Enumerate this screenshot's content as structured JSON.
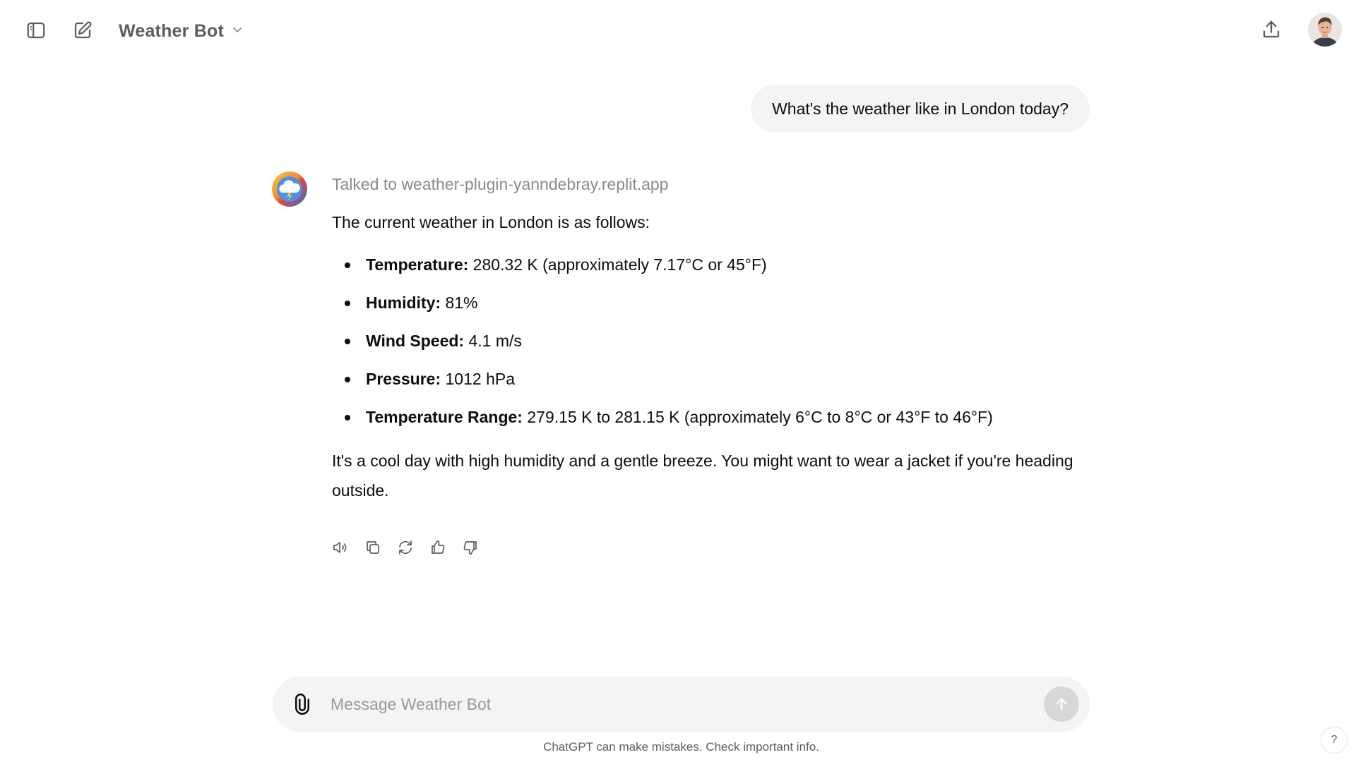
{
  "header": {
    "model_name": "Weather Bot"
  },
  "conversation": {
    "user_message": "What's the weather like in London today?",
    "assistant": {
      "plugin_note": "Talked to weather-plugin-yanndebray.replit.app",
      "intro": "The current weather in London is as follows:",
      "facts": [
        {
          "label": "Temperature:",
          "value": " 280.32 K (approximately 7.17°C or 45°F)"
        },
        {
          "label": "Humidity:",
          "value": " 81%"
        },
        {
          "label": "Wind Speed:",
          "value": " 4.1 m/s"
        },
        {
          "label": "Pressure:",
          "value": " 1012 hPa"
        },
        {
          "label": "Temperature Range:",
          "value": " 279.15 K to 281.15 K (approximately 6°C to 8°C or 43°F to 46°F)"
        }
      ],
      "outro": "It's a cool day with high humidity and a gentle breeze. You might want to wear a jacket if you're heading outside."
    },
    "actions": [
      "speaker-icon",
      "copy-icon",
      "regenerate-icon",
      "thumbs-up-icon",
      "thumbs-down-icon"
    ]
  },
  "composer": {
    "placeholder": "Message Weather Bot"
  },
  "footer": {
    "disclaimer": "ChatGPT can make mistakes. Check important info.",
    "help": "?"
  },
  "colors": {
    "bubble": "#f4f4f4",
    "muted_text": "#8a8a8a",
    "send_disabled": "#d7d7d7"
  }
}
